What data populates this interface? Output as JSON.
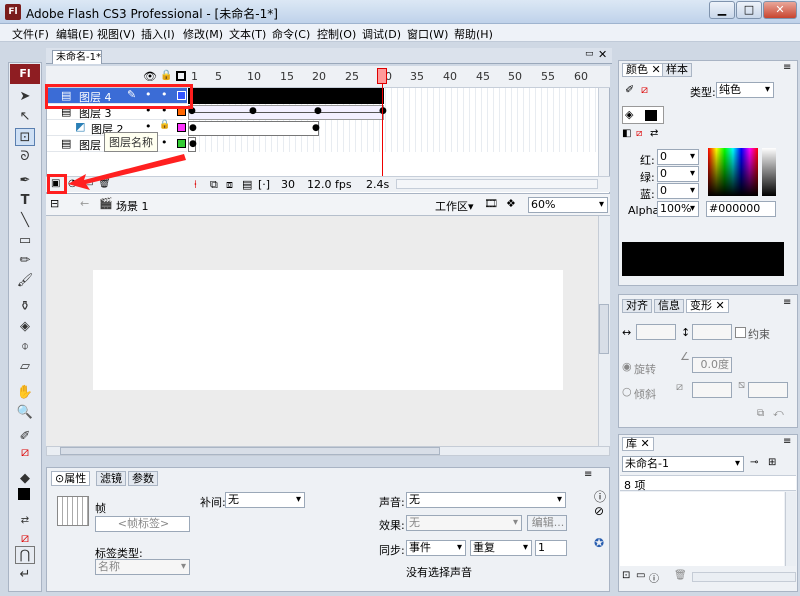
{
  "window": {
    "title": "Adobe Flash CS3 Professional - [未命名-1*]",
    "app_icon": "Fl",
    "buttons": [
      "minimize",
      "maximize",
      "close"
    ]
  },
  "menu": [
    "文件(F)",
    "编辑(E)",
    "视图(V)",
    "插入(I)",
    "修改(M)",
    "文本(T)",
    "命令(C)",
    "控制(O)",
    "调试(D)",
    "窗口(W)",
    "帮助(H)"
  ],
  "document_tab": "未命名-1*",
  "timeline": {
    "frame_numbers": [
      "1",
      "5",
      "10",
      "15",
      "20",
      "25",
      "30",
      "35",
      "40",
      "45",
      "50",
      "55",
      "60"
    ],
    "layers": [
      {
        "name": "图层 4",
        "color": "#3355ff",
        "selected": true
      },
      {
        "name": "图层 3",
        "color": "#ff6600"
      },
      {
        "name": "图层 2",
        "color": "#ff33ff"
      },
      {
        "name": "图层 1",
        "color": "#33cc33"
      }
    ],
    "tooltip": "图层名称",
    "current_frame": "30",
    "fps": "12.0 fps",
    "elapsed": "2.4s"
  },
  "scene": {
    "name": "场景 1",
    "workspace": "工作区",
    "zoom": "60%"
  },
  "properties": {
    "tabs": [
      "属性",
      "滤镜",
      "参数"
    ],
    "frame_label": "帧",
    "frame_name_placeholder": "<帧标签>",
    "label_type_label": "标签类型:",
    "label_type_value": "名称",
    "tween_label": "补间:",
    "tween_value": "无",
    "sound_label": "声音:",
    "sound_value": "无",
    "effect_label": "效果:",
    "effect_value": "无",
    "edit_button": "编辑...",
    "sync_label": "同步:",
    "sync_value": "事件",
    "repeat_value": "重复",
    "repeat_count": "1",
    "no_sound": "没有选择声音"
  },
  "color_panel": {
    "tabs": [
      "颜色",
      "样本"
    ],
    "type_label": "类型:",
    "type_value": "纯色",
    "red_label": "红:",
    "green_label": "绿:",
    "blue_label": "蓝:",
    "red": "0",
    "green": "0",
    "blue": "0",
    "alpha_label": "Alpha:",
    "alpha": "100%",
    "hex": "#000000"
  },
  "align_panel": {
    "tabs": [
      "对齐",
      "信息",
      "变形"
    ],
    "constrain": "约束",
    "rotate": "旋转",
    "rotate_value": "0.0度",
    "skew": "倾斜"
  },
  "library_panel": {
    "tab": "库",
    "document": "未命名-1",
    "count": "8 项"
  }
}
